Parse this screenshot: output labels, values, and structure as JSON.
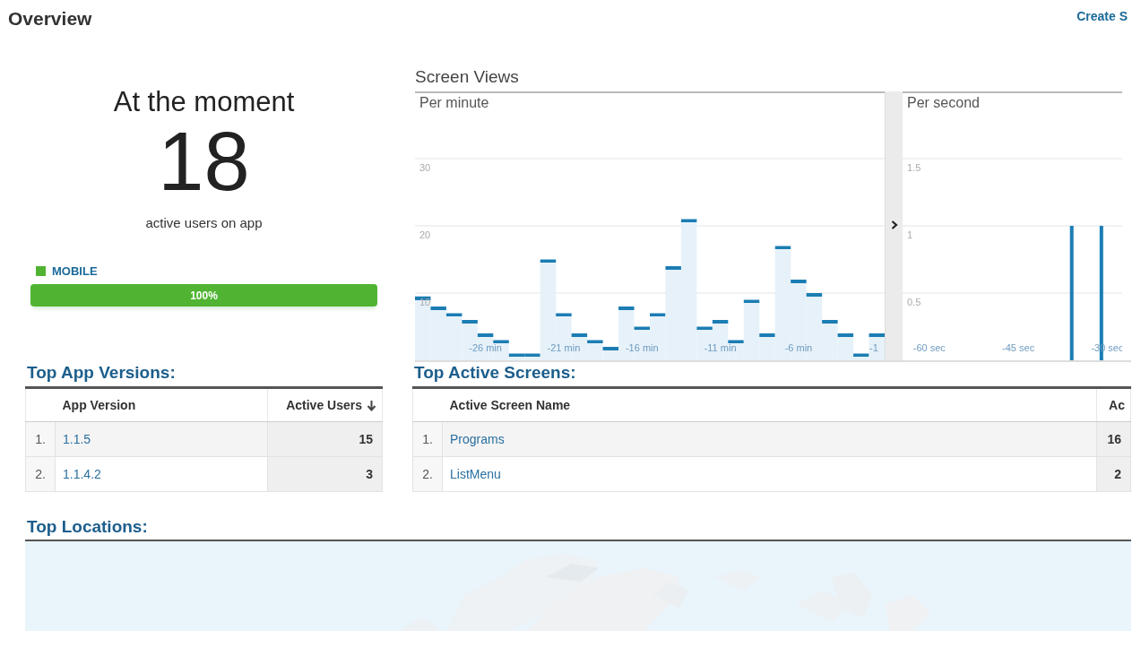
{
  "page": {
    "title": "Overview",
    "action_link": "Create S"
  },
  "realtime": {
    "heading": "At the moment",
    "count": "18",
    "caption": "active users on app",
    "segments": [
      {
        "label": "MOBILE",
        "color": "#50b432",
        "level": 1,
        "reading": "100%"
      }
    ]
  },
  "screen_views": {
    "title": "Screen Views",
    "charts": [
      {
        "chart_data": {
          "type": "bar",
          "title": "Per minute",
          "x": [
            -30,
            -29,
            -28,
            -27,
            -26,
            -25,
            -24,
            -23,
            -22,
            -21,
            -20,
            -19,
            -18,
            -17,
            -16,
            -15,
            -14,
            -13,
            -12,
            -11,
            -10,
            -9,
            -8,
            -7,
            -6,
            -5,
            -4,
            -3,
            -2,
            -1
          ],
          "values": [
            9.5,
            8,
            7,
            6,
            4,
            3,
            1,
            1,
            15,
            7,
            4,
            3,
            2,
            8,
            5,
            7,
            14,
            21,
            5,
            6,
            3,
            9,
            4,
            17,
            12,
            10,
            6,
            4,
            1,
            4
          ],
          "xlim": [
            -30.5,
            -0.5
          ],
          "ylim": [
            0,
            40
          ],
          "grid": true,
          "yticks": [
            10,
            20,
            30
          ],
          "xticks": [
            {
              "value": -26,
              "label": "-26 min"
            },
            {
              "value": -21,
              "label": "-21 min"
            },
            {
              "value": -16,
              "label": "-16 min"
            },
            {
              "value": -11,
              "label": "-11 min"
            },
            {
              "value": -6,
              "label": "-6 min"
            },
            {
              "value": -1,
              "label": "-1"
            }
          ]
        }
      },
      {
        "chart_data": {
          "type": "bar",
          "title": "Per second",
          "x": [
            -64,
            -63,
            -62,
            -61,
            -60,
            -59,
            -58,
            -57,
            -56,
            -55,
            -54,
            -53,
            -52,
            -51,
            -50,
            -49,
            -48,
            -47,
            -46,
            -45,
            -44,
            -43,
            -42,
            -41,
            -40,
            -39,
            -38,
            -37,
            -36,
            -35,
            -34,
            -33,
            -32,
            -31,
            -30,
            -29,
            -28
          ],
          "values": [
            0,
            0,
            0,
            0,
            0,
            0,
            0,
            0,
            0,
            0,
            0,
            0,
            0,
            0,
            0,
            0,
            0,
            0,
            0,
            0,
            0,
            0,
            0,
            0,
            0,
            0,
            0,
            0,
            1,
            0,
            0,
            0,
            0,
            1,
            0,
            0,
            0
          ],
          "xlim": [
            -64.5,
            -27.5
          ],
          "ylim": [
            0,
            2
          ],
          "grid": true,
          "yticks": [
            0.5,
            1,
            1.5
          ],
          "xticks": [
            {
              "value": -60,
              "label": "-60 sec"
            },
            {
              "value": -45,
              "label": "-45 sec"
            },
            {
              "value": -30,
              "label": "-30 sec"
            }
          ]
        }
      }
    ]
  },
  "tables": [
    {
      "title": "Top App Versions:",
      "columns": [
        {
          "label": "App Version"
        },
        {
          "label": "Active Users",
          "sorted": true,
          "sort_arrow": true
        }
      ],
      "rows": [
        {
          "index": "1.",
          "name": "1.1.5",
          "value": "15"
        },
        {
          "index": "2.",
          "name": "1.1.4.2",
          "value": "3"
        }
      ]
    },
    {
      "title": "Top Active Screens:",
      "columns": [
        {
          "label": "Active Screen Name"
        },
        {
          "label": "Ac",
          "sorted": true,
          "sort_arrow": false
        }
      ],
      "rows": [
        {
          "index": "1.",
          "name": "Programs",
          "value": "16"
        },
        {
          "index": "2.",
          "name": "ListMenu",
          "value": "2"
        }
      ]
    }
  ],
  "locations": {
    "title": "Top Locations:"
  }
}
